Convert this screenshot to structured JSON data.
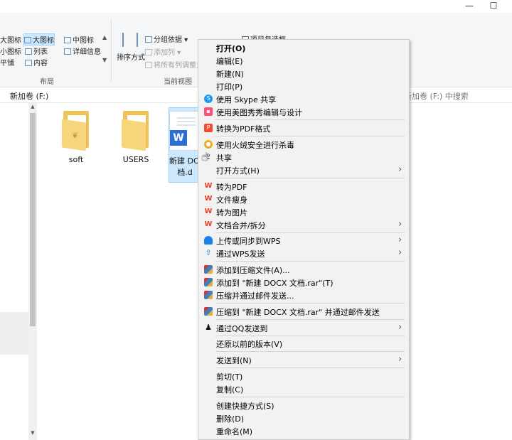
{
  "window": {
    "minimize_glyph": "—",
    "maximize_glyph": "☐"
  },
  "ribbon": {
    "layout": {
      "label": "布局",
      "items": [
        "大图标",
        "大图标",
        "中图标",
        "小图标",
        "列表",
        "详细信息",
        "平铺",
        "内容"
      ]
    },
    "current_view": {
      "label": "当前视图",
      "sort_label": "排序方式",
      "group_by": "分组依据",
      "add_column": "添加列",
      "fit_columns": "将所有列调整为"
    },
    "show_hide": {
      "item_checkbox": "项目复选框"
    }
  },
  "address": {
    "path": "新加卷 (F:)",
    "search_placeholder": "新加卷 (F:) 中搜索"
  },
  "files": [
    {
      "name": "soft"
    },
    {
      "name": "USERS"
    },
    {
      "name_line1": "新建 DOC",
      "name_line2": "档.d"
    }
  ],
  "context_menu": {
    "items": [
      {
        "label": "打开(O)"
      },
      {
        "label": "编辑(E)"
      },
      {
        "label": "新建(N)"
      },
      {
        "label": "打印(P)"
      },
      {
        "label": "使用 Skype 共享"
      },
      {
        "label": "使用美图秀秀编辑与设计"
      },
      {
        "label": "转换为PDF格式"
      },
      {
        "label": "使用火绒安全进行杀毒"
      },
      {
        "label": "共享"
      },
      {
        "label": "打开方式(H)"
      },
      {
        "label": "转为PDF"
      },
      {
        "label": "文件瘦身"
      },
      {
        "label": "转为图片"
      },
      {
        "label": "文档合并/拆分"
      },
      {
        "label": "上传或同步到WPS"
      },
      {
        "label": "通过WPS发送"
      },
      {
        "label": "添加到压缩文件(A)..."
      },
      {
        "label": "添加到 \"新建 DOCX 文档.rar\"(T)"
      },
      {
        "label": "压缩并通过邮件发送..."
      },
      {
        "label": "压缩到 \"新建 DOCX 文档.rar\" 并通过邮件发送"
      },
      {
        "label": "通过QQ发送到"
      },
      {
        "label": "还原以前的版本(V)"
      },
      {
        "label": "发送到(N)"
      },
      {
        "label": "剪切(T)"
      },
      {
        "label": "复制(C)"
      },
      {
        "label": "创建快捷方式(S)"
      },
      {
        "label": "删除(D)"
      },
      {
        "label": "重命名(M)"
      }
    ]
  }
}
